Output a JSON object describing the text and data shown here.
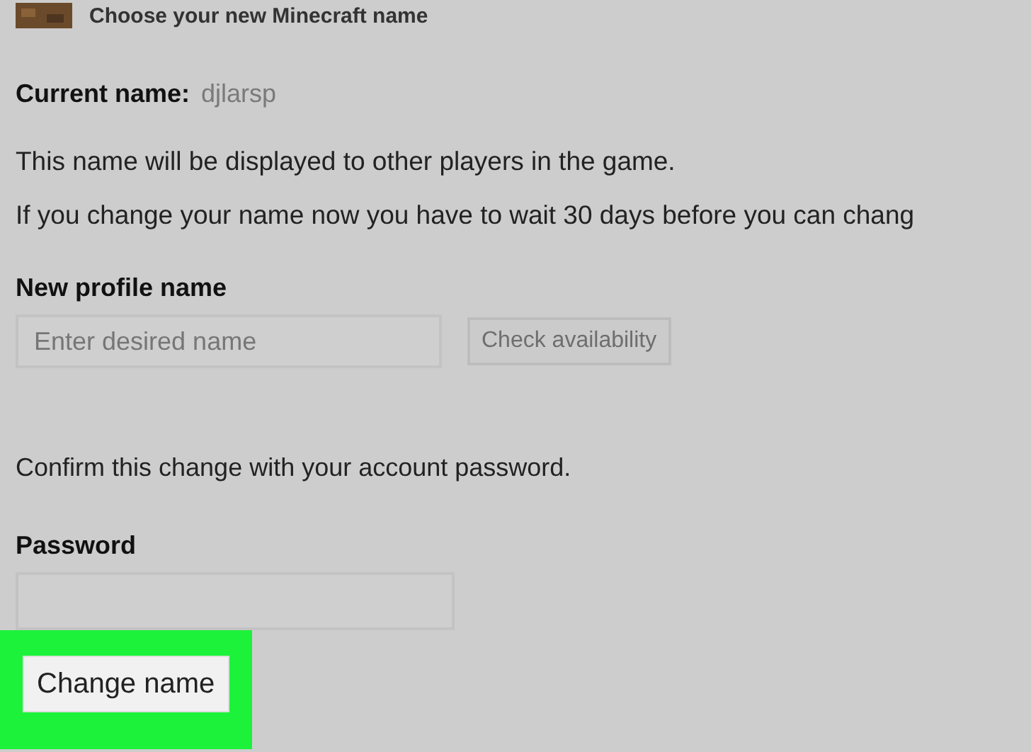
{
  "title": "Choose your new Minecraft name",
  "current_name": {
    "label": "Current name:",
    "value": "djlarsp"
  },
  "info": [
    "This name will be displayed to other players in the game.",
    "If you change your name now you have to wait 30 days before you can chang"
  ],
  "new_name": {
    "label": "New profile name",
    "placeholder": "Enter desired name",
    "button": {
      "label": "Check availability",
      "disabled": true
    }
  },
  "confirm_text": "Confirm this change with your account password.",
  "password": {
    "label": "Password"
  },
  "submit": {
    "label": "Change name",
    "highlighted": true
  }
}
